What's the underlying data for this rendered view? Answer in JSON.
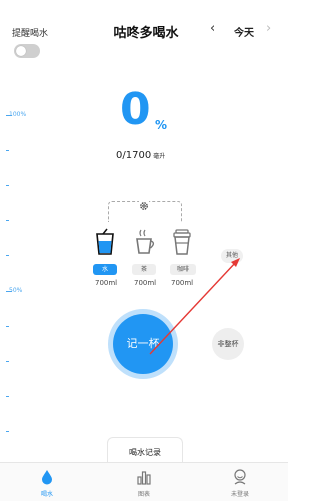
{
  "header": {
    "reminder_label": "提醒喝水",
    "title": "咕咚多喝水",
    "prev_icon": "‹",
    "day_label": "今天",
    "next_icon": "›"
  },
  "reminder_toggle": {
    "on": false
  },
  "scale": {
    "top_label": "100%",
    "mid_label": "50%"
  },
  "intake": {
    "percent": "0",
    "percent_sign": "%",
    "amount": "0/1700",
    "unit": "毫升"
  },
  "drinks": [
    {
      "icon": "water-cup-icon",
      "label": "水",
      "volume": "700ml",
      "active": true
    },
    {
      "icon": "tea-cup-icon",
      "label": "茶",
      "volume": "700ml",
      "active": false
    },
    {
      "icon": "coffee-cup-icon",
      "label": "咖啡",
      "volume": "700ml",
      "active": false
    }
  ],
  "other_button": "其他",
  "record_button": "记一杯",
  "irregular_button": "非整杯",
  "water_log_tab": "喝水记录",
  "tabbar": [
    {
      "icon": "water-drop-icon",
      "label": "喝水",
      "active": true
    },
    {
      "icon": "bar-chart-icon",
      "label": "图表",
      "active": false
    },
    {
      "icon": "user-icon",
      "label": "未登录",
      "active": false
    }
  ],
  "colors": {
    "accent": "#2196f3",
    "accent_light": "#bfe0fb",
    "annotation": "#e53935"
  }
}
